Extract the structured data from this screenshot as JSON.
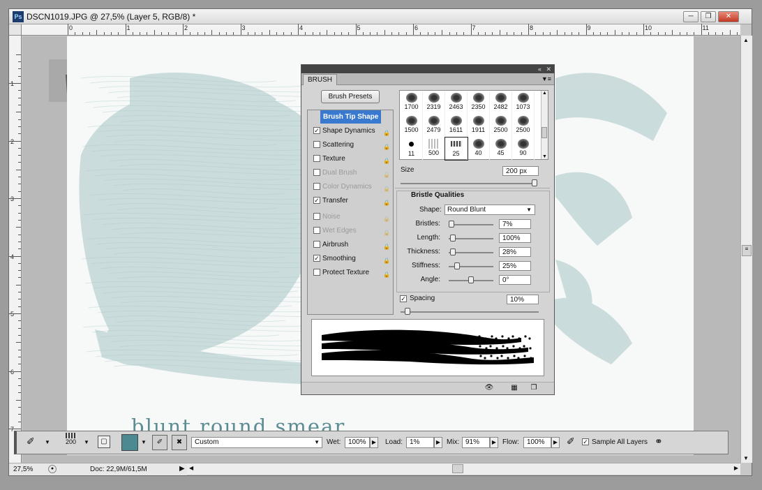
{
  "app": {
    "logo": "Ps",
    "document_title": "DSCN1019.JPG @ 27,5% (Layer 5, RGB/8) *",
    "window_buttons": [
      "minimize-icon",
      "restore-icon",
      "close-icon"
    ]
  },
  "rulers": {
    "h_labels": [
      "0",
      "1",
      "2",
      "3",
      "4",
      "5",
      "6",
      "7",
      "8",
      "9",
      "10",
      "11"
    ],
    "v_labels": [
      "1",
      "2",
      "3",
      "4",
      "5",
      "6",
      "7"
    ]
  },
  "canvas": {
    "caption": "blunt round smear",
    "smear_color": "#a9c5c7"
  },
  "status": {
    "zoom": "27,5%",
    "doc_size": "Doc: 22,9M/61,5M"
  },
  "brush_panel": {
    "tab": "BRUSH",
    "presets_button": "Brush Presets",
    "options": [
      {
        "label": "Brush Tip Shape",
        "checkbox": false,
        "checked": false,
        "lock": false,
        "dim": false,
        "selected": true
      },
      {
        "label": "Shape Dynamics",
        "checkbox": true,
        "checked": true,
        "lock": true,
        "dim": false,
        "selected": false
      },
      {
        "label": "Scattering",
        "checkbox": true,
        "checked": false,
        "lock": true,
        "dim": false,
        "selected": false
      },
      {
        "label": "Texture",
        "checkbox": true,
        "checked": false,
        "lock": true,
        "dim": false,
        "selected": false
      },
      {
        "label": "Dual Brush",
        "checkbox": true,
        "checked": false,
        "lock": true,
        "dim": true,
        "selected": false
      },
      {
        "label": "Color Dynamics",
        "checkbox": true,
        "checked": false,
        "lock": true,
        "dim": true,
        "selected": false
      },
      {
        "label": "Transfer",
        "checkbox": true,
        "checked": true,
        "lock": true,
        "dim": false,
        "selected": false
      },
      {
        "label": "Noise",
        "checkbox": true,
        "checked": false,
        "lock": true,
        "dim": true,
        "selected": false
      },
      {
        "label": "Wet Edges",
        "checkbox": true,
        "checked": false,
        "lock": true,
        "dim": true,
        "selected": false
      },
      {
        "label": "Airbrush",
        "checkbox": true,
        "checked": false,
        "lock": true,
        "dim": false,
        "selected": false
      },
      {
        "label": "Smoothing",
        "checkbox": true,
        "checked": true,
        "lock": true,
        "dim": false,
        "selected": false
      },
      {
        "label": "Protect Texture",
        "checkbox": true,
        "checked": false,
        "lock": true,
        "dim": false,
        "selected": false
      }
    ],
    "brush_sizes": [
      "1700",
      "2319",
      "2463",
      "2350",
      "2482",
      "1073",
      "1500",
      "2479",
      "1611",
      "1911",
      "2500",
      "2500",
      "11",
      "500",
      "25",
      "40",
      "45",
      "90"
    ],
    "selected_brush_index": 14,
    "size_label": "Size",
    "size_value": "200 px",
    "size_level": 0.98,
    "bristle_title": "Bristle Qualities",
    "shape_label": "Shape:",
    "shape_value": "Round Blunt",
    "params": [
      {
        "label": "Bristles:",
        "value": "7%",
        "level": 0.07
      },
      {
        "label": "Length:",
        "value": "100%",
        "level": 0.1
      },
      {
        "label": "Thickness:",
        "value": "28%",
        "level": 0.1
      },
      {
        "label": "Stiffness:",
        "value": "25%",
        "level": 0.18
      },
      {
        "label": "Angle:",
        "value": "0°",
        "level": 0.5
      }
    ],
    "spacing_label": "Spacing",
    "spacing_value": "10%",
    "spacing_level": 0.05
  },
  "options_bar": {
    "brush_size": "200",
    "mode": "Custom",
    "wet_label": "Wet:",
    "wet_value": "100%",
    "load_label": "Load:",
    "load_value": "1%",
    "mix_label": "Mix:",
    "mix_value": "91%",
    "flow_label": "Flow:",
    "flow_value": "100%",
    "sample_label": "Sample All Layers",
    "sample_checked": true,
    "color": "#4a8a90"
  }
}
